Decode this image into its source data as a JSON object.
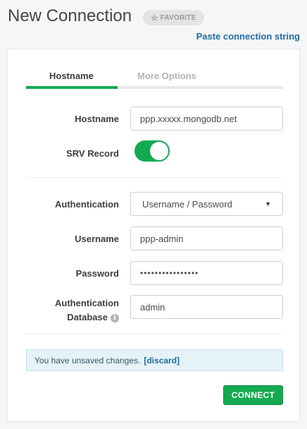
{
  "header": {
    "title": "New Connection",
    "favorite_icon": "star-icon",
    "favorite_label": "FAVORITE",
    "paste_link": "Paste connection string"
  },
  "tabs": [
    {
      "label": "Hostname",
      "active": true
    },
    {
      "label": "More Options",
      "active": false
    }
  ],
  "form": {
    "hostname_label": "Hostname",
    "hostname_value": "ppp.xxxxx.mongodb.net",
    "srv_label": "SRV Record",
    "srv_enabled": true,
    "auth_label": "Authentication",
    "auth_value": "Username / Password",
    "username_label": "Username",
    "username_value": "ppp-admin",
    "password_label": "Password",
    "password_value": "••••••••••••••••",
    "authdb_label_1": "Authentication",
    "authdb_label_2": "Database",
    "authdb_value": "admin"
  },
  "notice": {
    "text": "You have unsaved changes.",
    "discard": "[discard]"
  },
  "actions": {
    "connect": "CONNECT"
  },
  "colors": {
    "accent_green": "#13aa52",
    "link_blue": "#1e6ba1",
    "notice_bg": "#e5f3f8"
  }
}
